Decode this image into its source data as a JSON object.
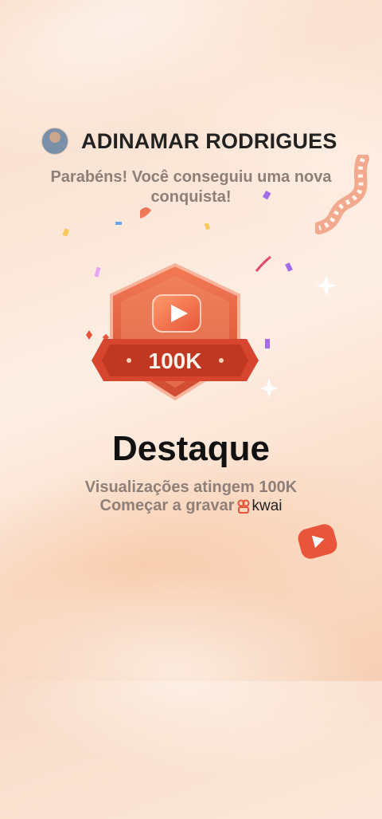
{
  "user": {
    "name": "ADINAMAR RODRIGUES"
  },
  "congrats_text": "Parabéns! Você conseguiu uma nova conquista!",
  "badge": {
    "label": "100K"
  },
  "achievement": {
    "title": "Destaque",
    "line1": "Visualizações atingem 100K",
    "line2": "Começar a gravar"
  },
  "brand": {
    "name": "kwai"
  },
  "colors": {
    "accent": "#e8553a",
    "badge_dark": "#c8402a",
    "text_muted": "#8e7f78"
  }
}
